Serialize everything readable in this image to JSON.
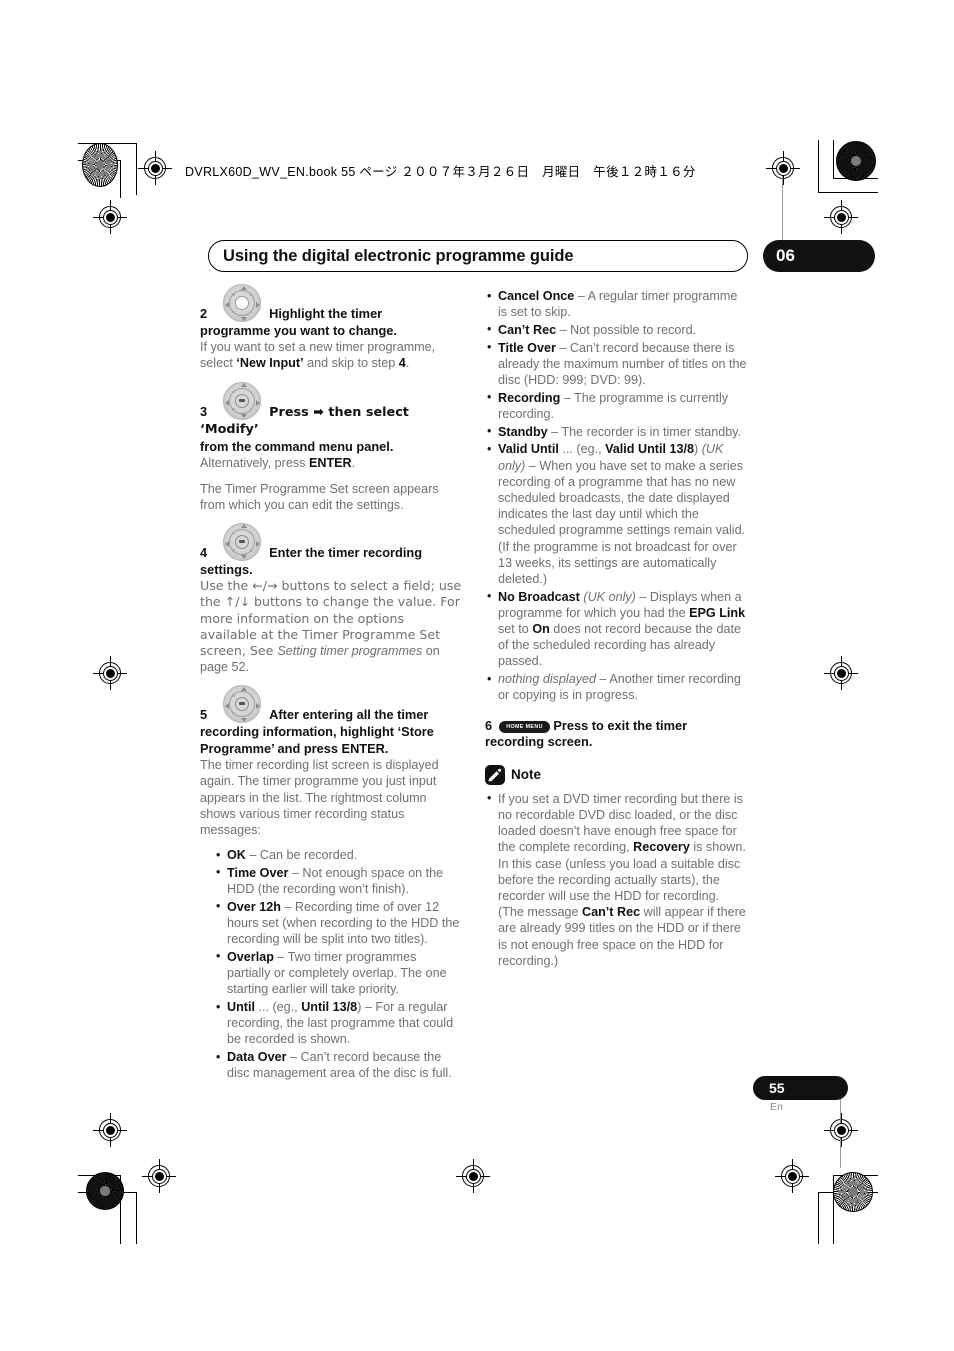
{
  "print_header": {
    "filename_line": "DVRLX60D_WV_EN.book  55 ページ  ２００７年３月２６日　月曜日　午後１２時１６分"
  },
  "header": {
    "chapter_title": "Using the digital electronic programme guide",
    "chapter_number": "06"
  },
  "footer": {
    "page_number": "55",
    "language": "En"
  },
  "left_column": {
    "steps": [
      {
        "number": "2",
        "icon": "dpad-icon",
        "heading_part1": "Highlight the timer",
        "heading_part2": "programme you want to change",
        "heading_end": ".",
        "body_lines": [
          "If you want to set a new timer programme,",
          "select ",
          "'New Input'",
          " and skip to step ",
          "4",
          "."
        ],
        "body_plain_1": "If you want to set a new timer programme, select ",
        "body_bold_1": "‘New Input’",
        "body_plain_2": " and skip to step ",
        "body_bold_2": "4",
        "body_plain_3": "."
      },
      {
        "number": "3",
        "icon": "dpad-enter-icon",
        "heading_part1": "Press ➡ then select ‘Modify’",
        "heading_part2": "from the command menu panel.",
        "body_plain_1": "Alternatively, press ",
        "body_bold_1": "ENTER",
        "body_plain_2": ".",
        "body_para_2": "The Timer Programme Set screen appears from which you can edit the settings."
      },
      {
        "number": "4",
        "icon": "dpad-enter-icon",
        "heading_part1": "Enter the timer recording",
        "heading_part2": "settings.",
        "body_plain_1": "Use the ←/→ buttons to select a field; use the ↑/↓ buttons to change the value. For more information on the options available at the Timer Programme Set screen, See ",
        "body_italic_1": "Setting timer programmes",
        "body_plain_2": " on page 52."
      },
      {
        "number": "5",
        "icon": "dpad-enter-icon",
        "heading_part1": "After entering all the timer",
        "heading_part2": "recording information, highlight ‘Store Programme’ and press ENTER.",
        "body_plain_1": "The timer recording list screen is displayed again. The timer programme you just input appears in the list. The rightmost column shows various timer recording status messages:"
      }
    ],
    "status_bullets": [
      {
        "term": "OK",
        "dash": " – ",
        "desc": "Can be recorded."
      },
      {
        "term": "Time Over",
        "dash": " – ",
        "desc": "Not enough space on the HDD (the recording won’t finish)."
      },
      {
        "term": "Over 12h",
        "dash": " – ",
        "desc": "Recording time of over 12 hours set (when recording to the HDD the recording will be split into two titles)."
      },
      {
        "term": "Overlap",
        "dash": " – ",
        "desc": "Two timer programmes partially or completely overlap. The one starting earlier will take priority."
      },
      {
        "term": "Until",
        "mid_plain": " ... (eg., ",
        "mid_bold": "Until 13/8",
        "mid_close": ")",
        "dash": " – ",
        "desc": "For a regular recording, the last programme that could be recorded is shown."
      },
      {
        "term": "Data Over",
        "dash": " – ",
        "desc": "Can’t record because the disc management area of the disc is full."
      }
    ]
  },
  "right_column": {
    "status_bullets": [
      {
        "term": "Cancel Once",
        "dash": " – ",
        "desc": "A regular timer programme is set to skip."
      },
      {
        "term": "Can’t Rec",
        "dash": " – ",
        "desc": "Not possible to record."
      },
      {
        "term": "Title Over",
        "dash": " – ",
        "desc": "Can’t record because there is already the maximum number of titles on the disc (HDD: 999; DVD: 99)."
      },
      {
        "term": "Recording",
        "dash": " – ",
        "desc": "The programme is currently recording."
      },
      {
        "term": "Standby",
        "dash": " – ",
        "desc": "The recorder is in timer standby."
      }
    ],
    "valid_until": {
      "term": "Valid Until",
      "mid_plain": " ... (eg., ",
      "mid_bold": "Valid Until 13/8",
      "mid_close": ") ",
      "uk_only": "(UK only)",
      "dash": " – ",
      "desc": "When you have set to make a series recording of a programme that has no new scheduled broadcasts, the date displayed indicates the last day until which the scheduled programme settings remain valid. (If the programme is not broadcast for over 13 weeks, its settings are automatically deleted.)"
    },
    "no_broadcast": {
      "term": "No Broadcast",
      "uk_only": " (UK only)",
      "dash": " – ",
      "desc_1": "Displays when a programme for which you had the ",
      "bold_1": "EPG Link",
      "desc_2": " set to ",
      "bold_2": "On",
      "desc_3": " does not record because the date of the scheduled recording has already passed."
    },
    "nothing_displayed": {
      "term_italic": "nothing displayed",
      "dash": " – ",
      "desc": "Another timer recording or copying is in progress."
    },
    "step6": {
      "number": "6",
      "key_label": "HOME MENU",
      "heading_part1": "Press to exit the timer",
      "heading_part2": "recording screen."
    },
    "note": {
      "icon": "note-pencil-icon",
      "label": "Note",
      "body_plain_1": "If you set a DVD timer recording but there is no recordable DVD disc loaded, or the disc loaded doesn’t have enough free space for the complete recording, ",
      "body_bold_1": "Recovery",
      "body_plain_2": " is shown. In this case (unless you load a suitable disc before the recording actually starts), the recorder will use the HDD for recording. (The message ",
      "body_bold_2": "Can’t Rec",
      "body_plain_3": " will appear if there are already 999 titles on the HDD or if there is not enough free space on the HDD for recording.)"
    }
  },
  "colors": {
    "body_text": "#6f7072",
    "heading_text": "#111111",
    "accent_fill": "#111111"
  }
}
